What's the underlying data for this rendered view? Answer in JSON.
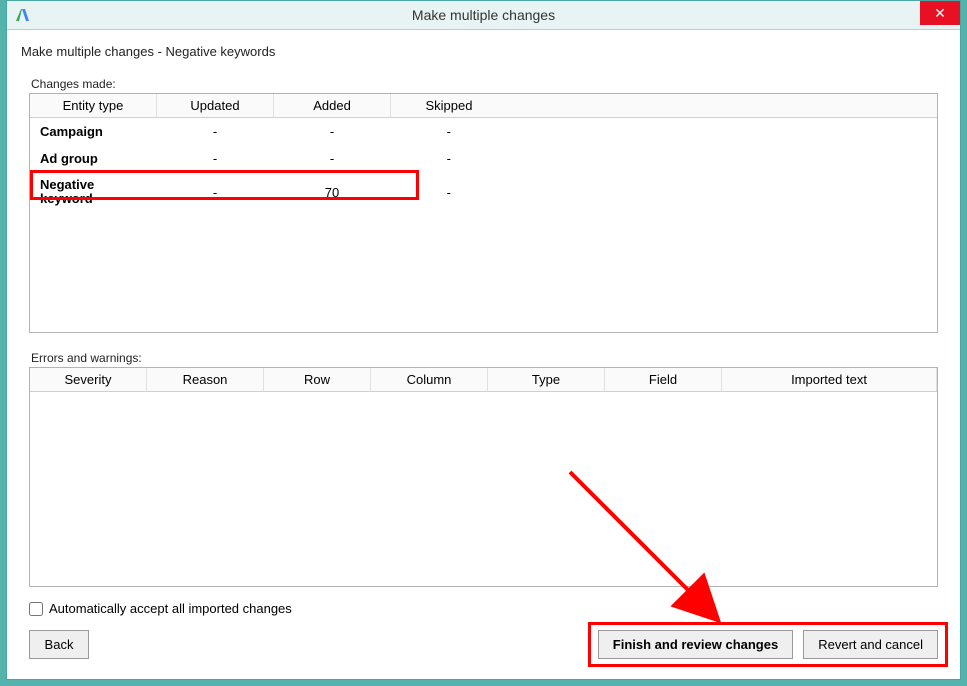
{
  "window": {
    "title": "Make multiple changes",
    "close_label": "✕"
  },
  "subtitle": "Make multiple changes - Negative keywords",
  "changes": {
    "label": "Changes made:",
    "headers": {
      "entity": "Entity type",
      "updated": "Updated",
      "added": "Added",
      "skipped": "Skipped"
    },
    "rows": [
      {
        "entity": "Campaign",
        "updated": "-",
        "added": "-",
        "skipped": "-"
      },
      {
        "entity": "Ad group",
        "updated": "-",
        "added": "-",
        "skipped": "-"
      },
      {
        "entity": "Negative keyword",
        "updated": "-",
        "added": "70",
        "skipped": "-"
      }
    ]
  },
  "errors": {
    "label": "Errors and warnings:",
    "headers": {
      "severity": "Severity",
      "reason": "Reason",
      "row": "Row",
      "column": "Column",
      "type": "Type",
      "field": "Field",
      "imported": "Imported text"
    }
  },
  "auto_accept": {
    "label": "Automatically accept all imported changes",
    "checked": false
  },
  "buttons": {
    "back": "Back",
    "finish": "Finish and review changes",
    "revert": "Revert and cancel"
  }
}
